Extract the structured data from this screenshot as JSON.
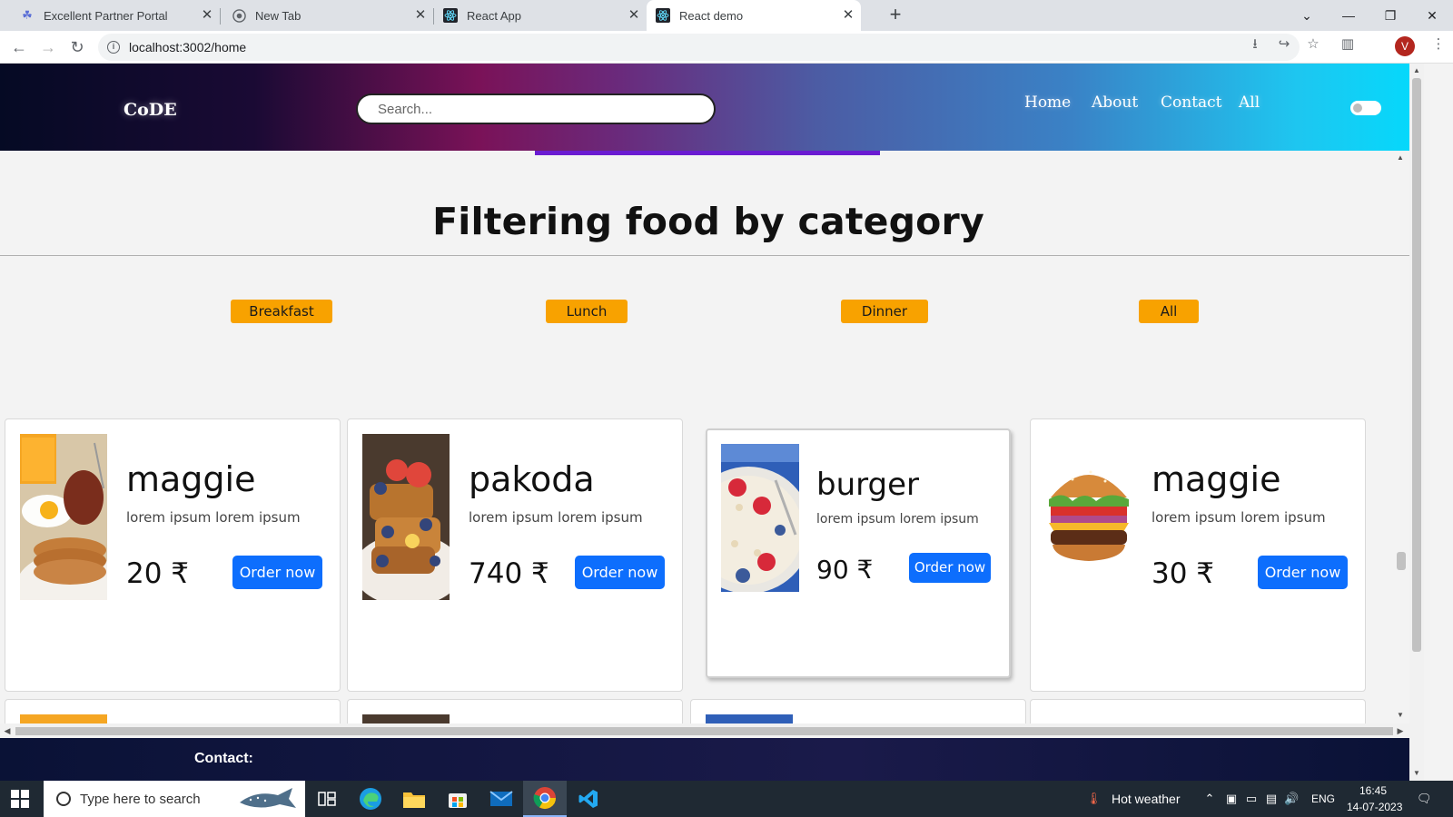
{
  "browser": {
    "tabs": [
      {
        "title": "Excellent Partner Portal",
        "icon": "partner-portal-icon"
      },
      {
        "title": "New Tab",
        "icon": "chrome-icon"
      },
      {
        "title": "React App",
        "icon": "react-icon"
      },
      {
        "title": "React demo",
        "icon": "react-icon",
        "active": true
      }
    ],
    "url": "localhost:3002/home",
    "profile_initial": "V"
  },
  "navbar": {
    "brand": "CoDE",
    "search_placeholder": "Search...",
    "links": [
      "Home",
      "About",
      "Contact",
      "All"
    ]
  },
  "page": {
    "heading": "Filtering food by category",
    "categories": [
      "Breakfast",
      "Lunch",
      "Dinner",
      "All"
    ],
    "currency": "₹",
    "cards": [
      {
        "title": "maggie",
        "desc": "lorem ipsum lorem ipsum",
        "price": "20 ₹",
        "button": "Order now",
        "image": "breakfast-plate"
      },
      {
        "title": "pakoda",
        "desc": "lorem ipsum lorem ipsum",
        "price": "740 ₹",
        "button": "Order now",
        "image": "french-toast"
      },
      {
        "title": "burger",
        "desc": "lorem ipsum lorem ipsum",
        "price": "90 ₹",
        "button": "Order now",
        "image": "oatmeal-berries"
      },
      {
        "title": "maggie",
        "desc": "lorem ipsum lorem ipsum",
        "price": "30 ₹",
        "button": "Order now",
        "image": "burger"
      }
    ],
    "footer_label": "Contact:"
  },
  "taskbar": {
    "search_placeholder": "Type here to search",
    "weather": "Hot weather",
    "language": "ENG",
    "time": "16:45",
    "date": "14-07-2023"
  },
  "colors": {
    "category_button": "#f8a200",
    "order_button": "#0d6efd",
    "nav_underline": "#6a1bd1"
  }
}
